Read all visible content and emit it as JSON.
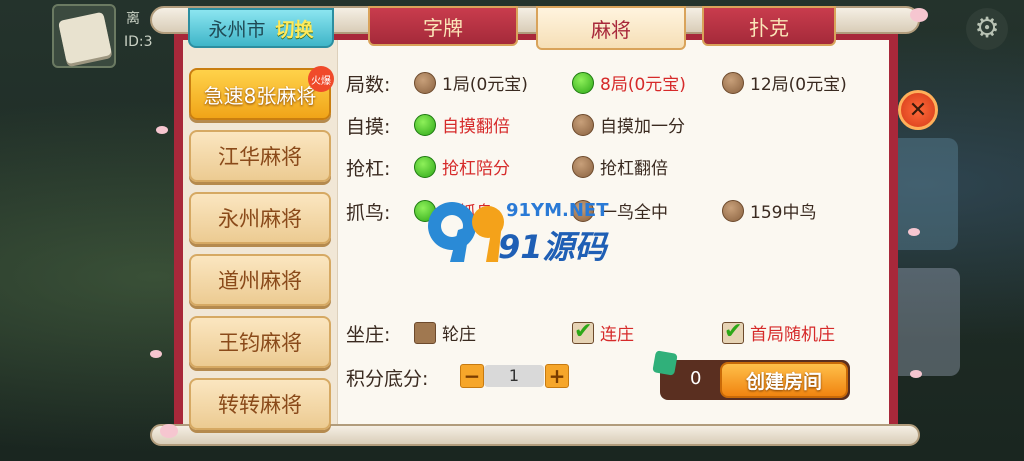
{
  "player": {
    "name": "离",
    "id_prefix": "ID:3"
  },
  "city_tab": {
    "city": "永州市",
    "switch_label": "切换"
  },
  "tabs": [
    {
      "label": "字牌",
      "active": false
    },
    {
      "label": "麻将",
      "active": true
    },
    {
      "label": "扑克",
      "active": false
    }
  ],
  "mahjong_list": [
    {
      "label": "急速8张麻将",
      "selected": true,
      "badge": "火爆"
    },
    {
      "label": "江华麻将",
      "selected": false
    },
    {
      "label": "永州麻将",
      "selected": false
    },
    {
      "label": "道州麻将",
      "selected": false
    },
    {
      "label": "王钧麻将",
      "selected": false
    },
    {
      "label": "转转麻将",
      "selected": false
    }
  ],
  "rules": {
    "rounds": {
      "label": "局数:",
      "options": [
        "1局(0元宝)",
        "8局(0元宝)",
        "12局(0元宝)"
      ],
      "selected": 1
    },
    "self_draw": {
      "label": "自摸:",
      "options": [
        "自摸翻倍",
        "自摸加一分"
      ],
      "selected": 0
    },
    "rob_kong": {
      "label": "抢杠:",
      "options": [
        "抢杠陪分",
        "抢杠翻倍"
      ],
      "selected": 0
    },
    "bird": {
      "label": "抓鸟:",
      "options": [
        "不抓鸟",
        "一鸟全中",
        "159中鸟"
      ],
      "selected": 0
    },
    "dealer": {
      "label": "坐庄:",
      "options": [
        "轮庄",
        "连庄",
        "首局随机庄"
      ],
      "checked": [
        false,
        true,
        true
      ]
    },
    "base_score": {
      "label": "积分底分:",
      "value": "1",
      "minus": "−",
      "plus": "+"
    }
  },
  "create_room": {
    "cost": "0",
    "label": "创建房间"
  },
  "close": {
    "symbol": "✕"
  },
  "settings_icon": "⚙",
  "watermark": {
    "line1": "91YM.NET",
    "line2": "91源码"
  },
  "colors": {
    "accent_red": "#a8283a",
    "selected_text": "#d62a2a",
    "tab_teal": "#3fb5c8",
    "button_orange": "#f08410"
  }
}
